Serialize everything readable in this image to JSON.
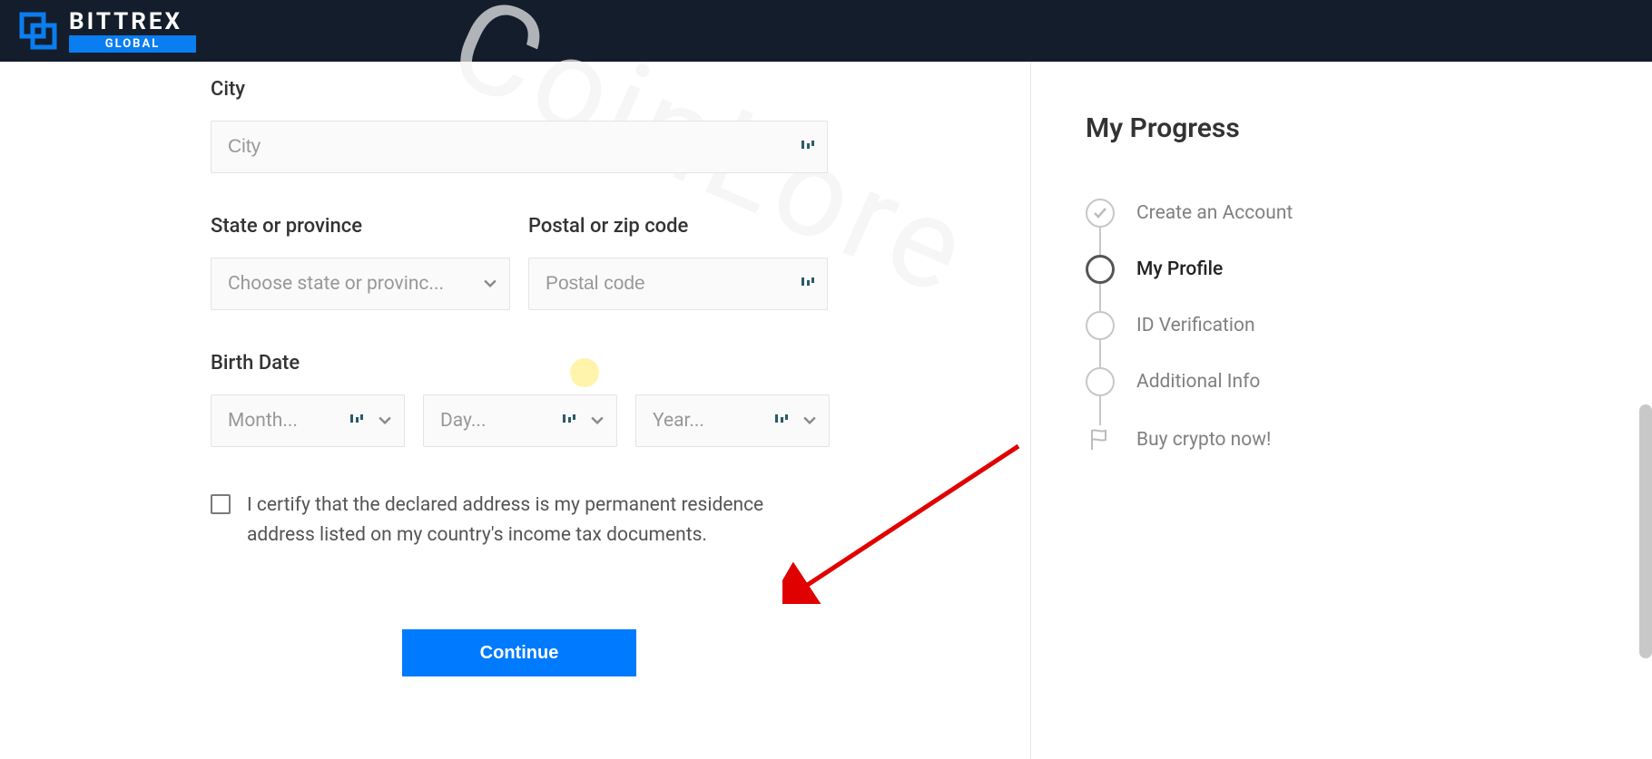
{
  "header": {
    "brand_main": "BITTRE",
    "brand_last": "X",
    "brand_sub": "GLOBAL"
  },
  "form": {
    "city_label": "City",
    "city_placeholder": "City",
    "state_label": "State or province",
    "state_placeholder": "Choose state or provinc...",
    "postal_label": "Postal or zip code",
    "postal_placeholder": "Postal code",
    "birthdate_label": "Birth Date",
    "month_placeholder": "Month...",
    "day_placeholder": "Day...",
    "year_placeholder": "Year...",
    "certify_text": "I certify that the declared address is my permanent residence address listed on my country's income tax documents.",
    "continue_label": "Continue"
  },
  "sidebar": {
    "title": "My Progress",
    "steps": [
      {
        "label": "Create an Account",
        "state": "done"
      },
      {
        "label": "My Profile",
        "state": "active"
      },
      {
        "label": "ID Verification",
        "state": "pending"
      },
      {
        "label": "Additional Info",
        "state": "pending"
      },
      {
        "label": "Buy crypto now!",
        "state": "goal"
      }
    ]
  },
  "watermark": "CoinLore"
}
